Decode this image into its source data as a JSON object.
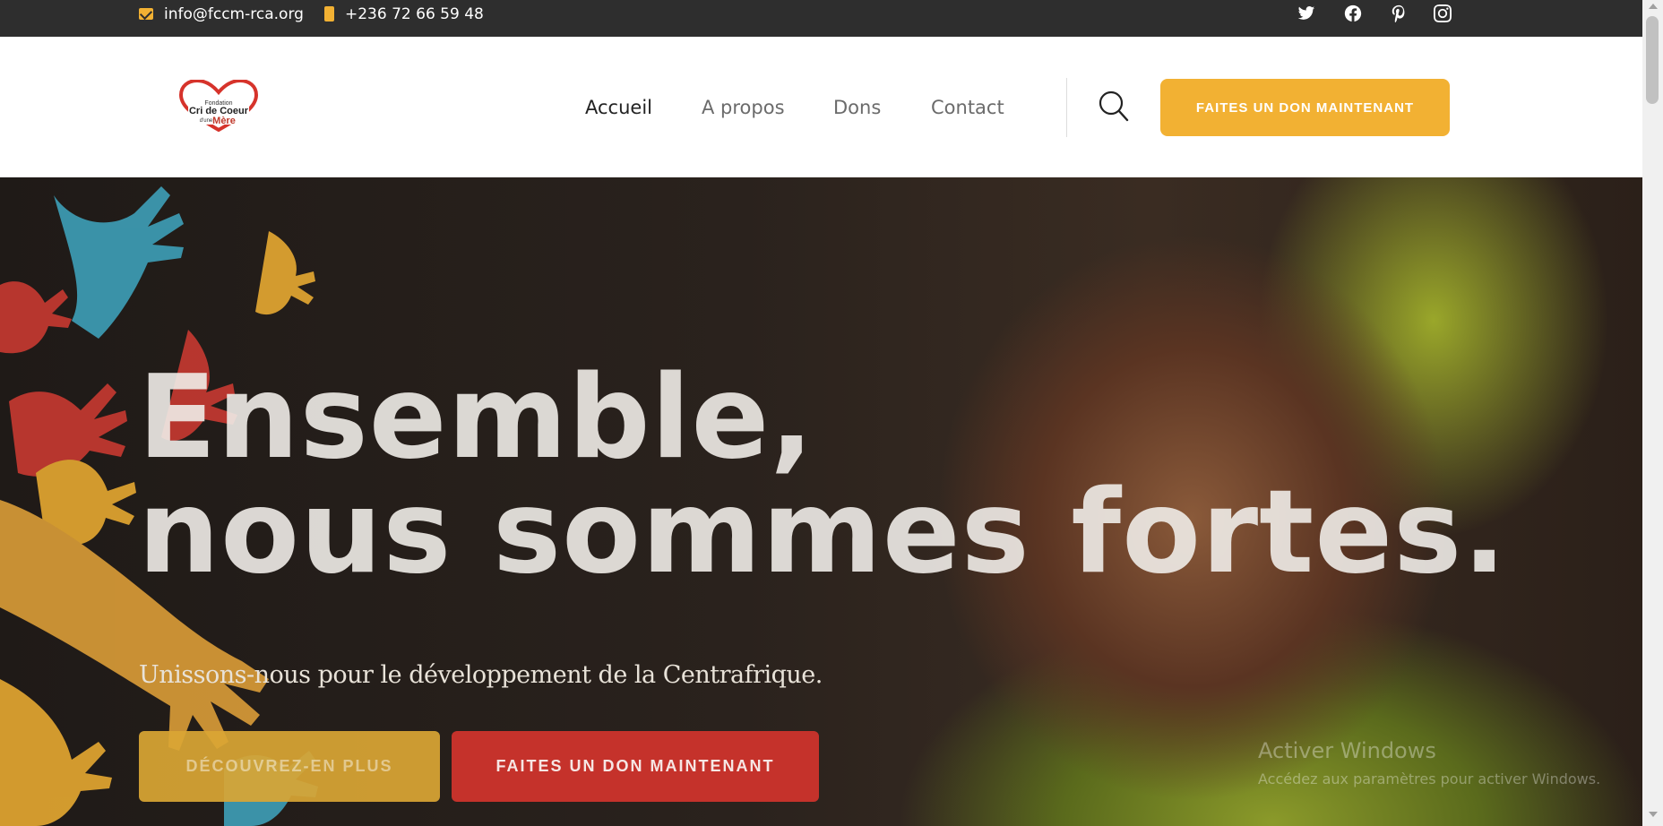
{
  "topbar": {
    "email": "info@fccm-rca.org",
    "phone": "+236 72 66 59 48",
    "email_icon": "envelope-icon",
    "phone_icon": "phone-icon",
    "social": [
      "twitter-icon",
      "facebook-icon",
      "pinterest-icon",
      "instagram-icon"
    ]
  },
  "header": {
    "logo": {
      "line1": "Fondation",
      "line2": "Cri de Coeur",
      "line3": "d'une",
      "line4": "Mère"
    },
    "nav": {
      "home": "Accueil",
      "about": "A propos",
      "dons": "Dons",
      "contact": "Contact"
    },
    "cta": "FAITES UN DON MAINTENANT"
  },
  "hero": {
    "title_line1": "Ensemble,",
    "title_line2": "nous sommes fortes.",
    "subtitle": "Unissons-nous pour le développement de la Centrafrique.",
    "button_more": "DÉCOUVREZ-EN PLUS",
    "button_donate": "FAITES UN DON MAINTENANT"
  },
  "watermark": {
    "line1": "Activer Windows",
    "line2": "Accédez aux paramètres pour activer Windows."
  },
  "colors": {
    "accent_yellow": "#f2b133",
    "accent_red": "#d3342d",
    "topbar_bg": "#2e2e2e"
  }
}
